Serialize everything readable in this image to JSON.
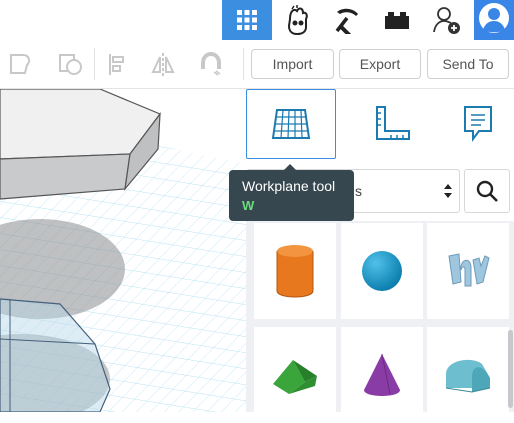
{
  "topbar": {
    "items": [
      {
        "name": "grid-view-icon",
        "active": true
      },
      {
        "name": "tinker-hand-icon"
      },
      {
        "name": "pickaxe-icon"
      },
      {
        "name": "bricks-icon"
      },
      {
        "name": "add-user-icon"
      }
    ],
    "avatar": "avatar"
  },
  "toolbar": {
    "import_label": "Import",
    "export_label": "Export",
    "sendto_label": "Send To",
    "tools": [
      "group-icon",
      "ungroup-icon",
      "align-icon",
      "mirror-icon",
      "cruise-icon"
    ]
  },
  "panel": {
    "tools": [
      "workplane-icon",
      "ruler-icon",
      "notes-icon"
    ],
    "select_value": "s",
    "shapes": [
      "cylinder",
      "sphere",
      "text-3d",
      "roof",
      "cone",
      "half-cylinder"
    ]
  },
  "tooltip": {
    "title": "Workplane tool",
    "key": "W"
  },
  "colors": {
    "accent": "#3b8ee0",
    "tooltip_bg": "#37474f",
    "shortcut": "#6bdc7e",
    "grid": "#a9ddf0"
  }
}
